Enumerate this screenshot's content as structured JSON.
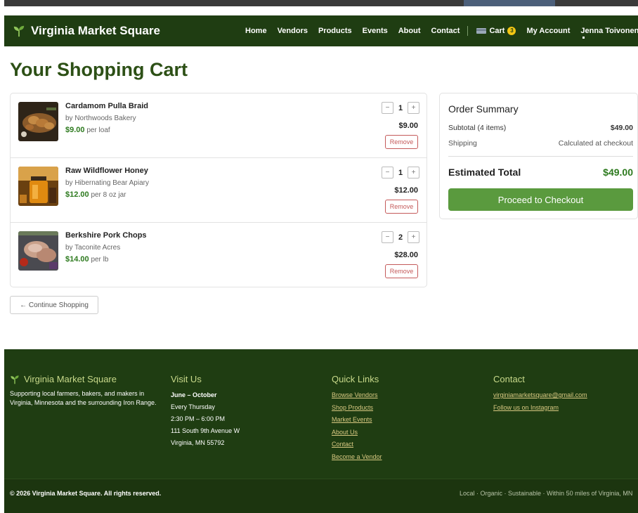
{
  "header": {
    "brand": "Virginia Market Square",
    "nav": [
      {
        "label": "Home"
      },
      {
        "label": "Vendors"
      },
      {
        "label": "Products"
      },
      {
        "label": "Events"
      },
      {
        "label": "About"
      },
      {
        "label": "Contact"
      }
    ],
    "cart_label": "Cart",
    "cart_count": "3",
    "account_label": "My Account",
    "user_name": "Jenna Toivonen"
  },
  "page_title": "Your Shopping Cart",
  "cart": {
    "items": [
      {
        "name": "Cardamom Pulla Braid",
        "vendor": "by Northwoods Bakery",
        "price": "$9.00",
        "unit": "per loaf",
        "qty": "1",
        "line_total": "$9.00",
        "remove_label": "Remove",
        "minus": "−",
        "plus": "+",
        "thumb_icon": "bread-photo"
      },
      {
        "name": "Raw Wildflower Honey",
        "vendor": "by Hibernating Bear Apiary",
        "price": "$12.00",
        "unit": "per 8 oz jar",
        "qty": "1",
        "line_total": "$12.00",
        "remove_label": "Remove",
        "minus": "−",
        "plus": "+",
        "thumb_icon": "honey-jar-photo"
      },
      {
        "name": "Berkshire Pork Chops",
        "vendor": "by Taconite Acres",
        "price": "$14.00",
        "unit": "per lb",
        "qty": "2",
        "line_total": "$28.00",
        "remove_label": "Remove",
        "minus": "−",
        "plus": "+",
        "thumb_icon": "pork-chops-photo"
      }
    ],
    "continue_label": "← Continue Shopping"
  },
  "summary": {
    "title": "Order Summary",
    "subtotal_label": "Subtotal (4 items)",
    "subtotal_value": "$49.00",
    "shipping_label": "Shipping",
    "shipping_value": "Calculated at checkout",
    "total_label": "Estimated Total",
    "total_value": "$49.00",
    "checkout_label": "Proceed to Checkout"
  },
  "footer": {
    "brand": "Virginia Market Square",
    "about": "Supporting local farmers, bakers, and makers in Virginia, Minnesota and the surrounding Iron Range.",
    "visit": {
      "title": "Visit Us",
      "season": "June – October",
      "day": "Every Thursday",
      "hours": "2:30 PM – 6:00 PM",
      "street": "111 South 9th Avenue W",
      "city": "Virginia, MN 55792"
    },
    "quick_links": {
      "title": "Quick Links",
      "links": [
        "Browse Vendors",
        "Shop Products",
        "Market Events",
        "About Us",
        "Contact",
        "Become a Vendor"
      ]
    },
    "contact": {
      "title": "Contact",
      "email": "virginiamarketsquare@gmail.com",
      "instagram": "Follow us on Instagram"
    },
    "copyright": "© 2026 Virginia Market Square. All rights reserved.",
    "tagline": "Local · Organic · Sustainable · Within 50 miles of Virginia, MN"
  },
  "colors": {
    "header_bg": "#1f3d12",
    "title_green": "#2d5016",
    "price_green": "#2d7a1e",
    "checkout_green": "#5a9a3e",
    "remove_red": "#c45a5a",
    "footer_heading": "#c8d98a",
    "footer_link": "#d9c982",
    "badge_yellow": "#f3c614"
  }
}
